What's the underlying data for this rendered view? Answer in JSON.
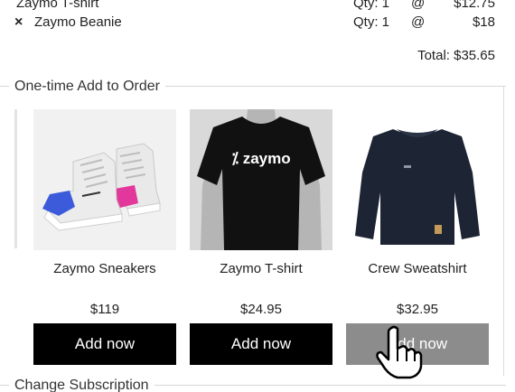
{
  "order": {
    "items": [
      {
        "name": "Zaymo T-shirt",
        "qty": "Qty: 1",
        "at": "@",
        "price": "$12.75",
        "removable": false
      },
      {
        "name": "Zaymo Beanie",
        "qty": "Qty: 1",
        "at": "@",
        "price": "$18",
        "removable": true,
        "remove_icon": "×"
      }
    ],
    "total": "Total: $35.65"
  },
  "addon_section": {
    "title": "One-time Add to Order",
    "products": [
      {
        "name": "Zaymo Sneakers",
        "price": "$119",
        "button": "Add now"
      },
      {
        "name": "Zaymo T-shirt",
        "price": "$24.95",
        "button": "Add now",
        "shirt_text": "zaymo"
      },
      {
        "name": "Crew Sweatshirt",
        "price": "$32.95",
        "button": "Add now"
      }
    ]
  },
  "change_section": {
    "title": "Change Subscription"
  },
  "icons": {
    "remove": "close-icon",
    "cursor": "hand-pointer-icon"
  },
  "colors": {
    "button_bg": "#000000",
    "button_hover_bg": "#8c8c8c",
    "shirt": "#111111",
    "sweatshirt": "#1d2433",
    "sneaker_blue": "#3b5bdb",
    "sneaker_pink": "#e2389b"
  }
}
